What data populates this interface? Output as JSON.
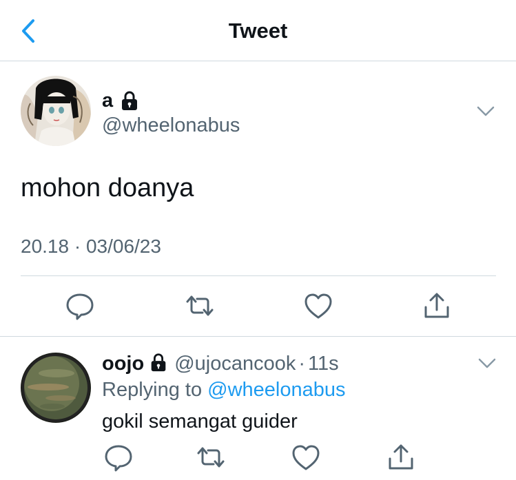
{
  "header": {
    "title": "Tweet",
    "back_icon": "chevron-left-icon"
  },
  "colors": {
    "accent": "#1d9bf0",
    "secondary_text": "#536471",
    "divider": "#cfd9de"
  },
  "tweet": {
    "name": "a",
    "protected_icon": "lock-icon",
    "handle": "@wheelonabus",
    "text": "mohon doanya",
    "timestamp": "20.18 · 03/06/23",
    "actions": [
      "reply-icon",
      "retweet-icon",
      "like-icon",
      "share-icon"
    ]
  },
  "reply": {
    "name": "oojo",
    "protected_icon": "lock-icon",
    "handle": "@ujocancook",
    "separator": "·",
    "time": "11s",
    "replying_prefix": "Replying to",
    "replying_to": "@wheelonabus",
    "text": "gokil semangat guider",
    "actions": [
      "reply-icon",
      "retweet-icon",
      "like-icon",
      "share-icon"
    ]
  }
}
